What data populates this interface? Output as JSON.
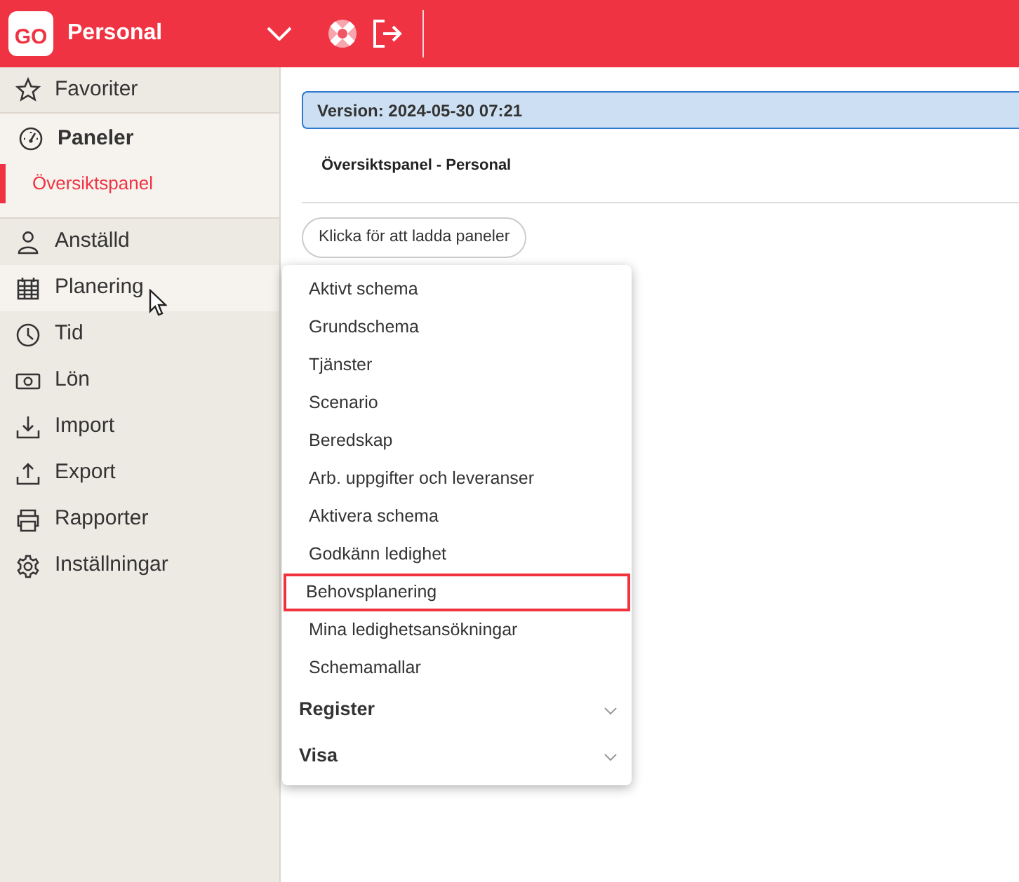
{
  "header": {
    "logo": "GO",
    "title": "Personal"
  },
  "sidebar": {
    "favorites": {
      "label": "Favoriter"
    },
    "panels": {
      "label": "Paneler",
      "items": [
        {
          "label": "Översiktspanel",
          "selected": true
        }
      ]
    },
    "items": [
      {
        "label": "Anställd",
        "selected": false
      },
      {
        "label": "Planering",
        "selected": true
      },
      {
        "label": "Tid",
        "selected": false
      },
      {
        "label": "Lön",
        "selected": false
      },
      {
        "label": "Import",
        "selected": false
      },
      {
        "label": "Export",
        "selected": false
      },
      {
        "label": "Rapporter",
        "selected": false
      },
      {
        "label": "Inställningar",
        "selected": false
      }
    ]
  },
  "main": {
    "version": "Version: 2024-05-30 07:21",
    "panel_title": "Översiktspanel - Personal",
    "load_button": "Klicka för att ladda paneler"
  },
  "menu": {
    "items": [
      {
        "label": "Aktivt schema",
        "selected": false
      },
      {
        "label": "Grundschema",
        "selected": false
      },
      {
        "label": "Tjänster",
        "selected": false
      },
      {
        "label": "Scenario",
        "selected": false
      },
      {
        "label": "Beredskap",
        "selected": false
      },
      {
        "label": "Arb. uppgifter och leveranser",
        "selected": false
      },
      {
        "label": "Aktivera schema",
        "selected": false
      },
      {
        "label": "Godkänn ledighet",
        "selected": false
      },
      {
        "label": "Behovsplanering",
        "selected": true
      },
      {
        "label": "Mina ledighetsansökningar",
        "selected": false
      },
      {
        "label": "Schemamallar",
        "selected": false
      }
    ],
    "sections": [
      {
        "label": "Register",
        "expanded": false
      },
      {
        "label": "Visa",
        "expanded": false
      }
    ]
  }
}
